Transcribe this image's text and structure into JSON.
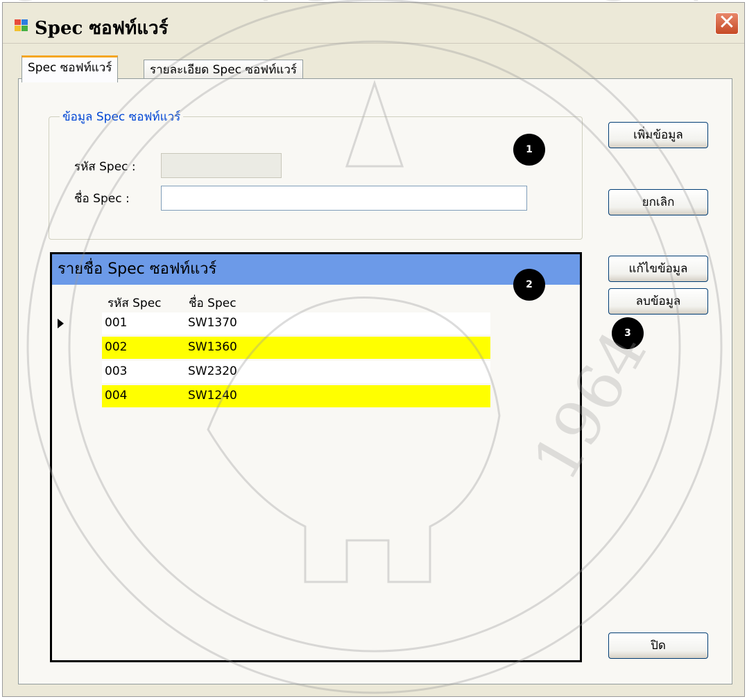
{
  "window": {
    "title_en": "Spec",
    "title_th": "ซอฟท์แวร์",
    "close_glyph": "✕"
  },
  "tabs": [
    {
      "label": "Spec ซอฟท์แวร์",
      "active": true
    },
    {
      "label": "รายละเอียด Spec ซอฟท์แวร์",
      "active": false
    }
  ],
  "form": {
    "group_title": "ข้อมูล Spec ซอฟท์แวร์",
    "code_label": "รหัส Spec :",
    "code_value": "",
    "name_label": "ชื่อ Spec :",
    "name_value": ""
  },
  "buttons": {
    "add": "เพิ่มข้อมูล",
    "cancel": "ยกเลิก",
    "edit": "แก้ไขข้อมูล",
    "delete": "ลบข้อมูล",
    "close": "ปิด"
  },
  "grid": {
    "caption": "รายชื่อ Spec ซอฟท์แวร์",
    "columns": [
      "รหัส Spec",
      "ชื่อ Spec"
    ],
    "rows": [
      {
        "code": "001",
        "name": "SW1370",
        "highlight": false,
        "current": true
      },
      {
        "code": "002",
        "name": "SW1360",
        "highlight": true,
        "current": false
      },
      {
        "code": "003",
        "name": "SW2320",
        "highlight": false,
        "current": false
      },
      {
        "code": "004",
        "name": "SW1240",
        "highlight": true,
        "current": false
      }
    ]
  },
  "callouts": [
    "1",
    "2",
    "3"
  ],
  "watermark": {
    "text": "CHIANG MAI UNIVERSITY",
    "year": "1964"
  },
  "colors": {
    "highlight_row": "#ffff00",
    "grid_caption": "#6c9ae8",
    "group_title": "#0046d5",
    "active_tab_accent": "#f5a623"
  }
}
